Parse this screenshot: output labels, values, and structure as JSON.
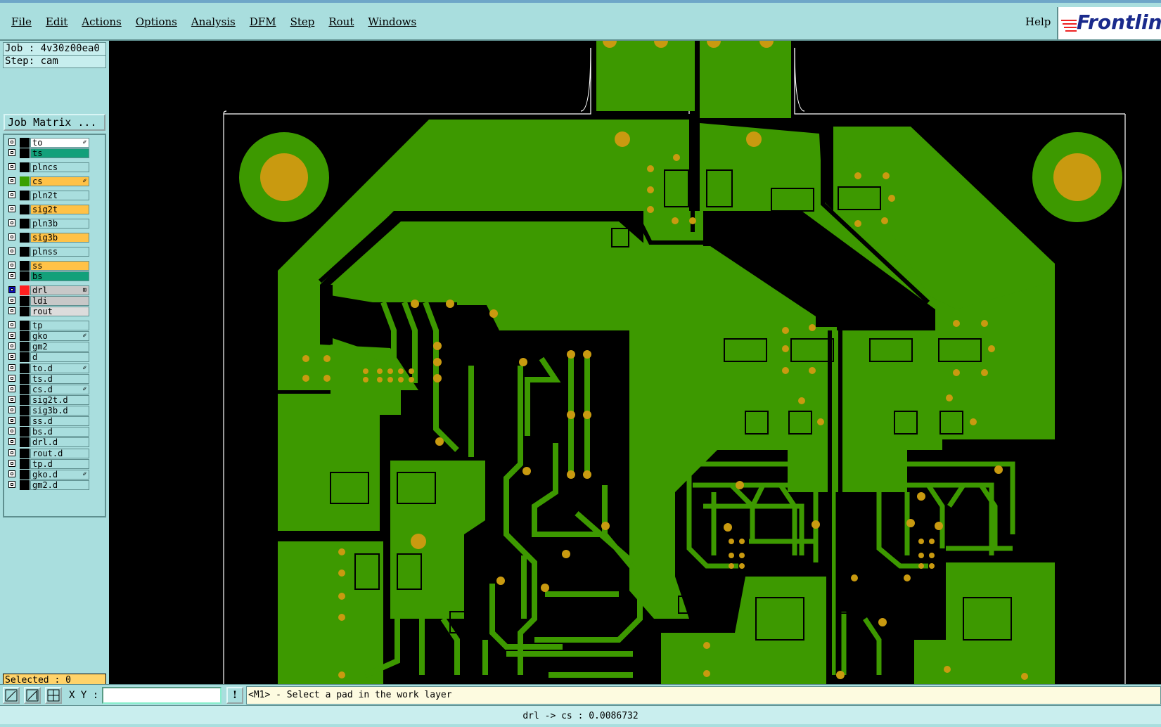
{
  "menu": {
    "items": [
      "File",
      "Edit",
      "Actions",
      "Options",
      "Analysis",
      "DFM",
      "Step",
      "Rout",
      "Windows"
    ],
    "help": "Help",
    "logo": "Frontline"
  },
  "job": {
    "label": "Job : 4v30z00ea0"
  },
  "step": {
    "label": "Step: cam"
  },
  "job_matrix_button": "Job Matrix ...",
  "layers": [
    {
      "name": "to",
      "bg": "#ffffff",
      "swatch": "#000000",
      "mark": "✐"
    },
    {
      "name": "ts",
      "bg": "#13a07a",
      "swatch": "#000000",
      "mark": ""
    },
    {
      "name": "plncs",
      "bg": "#a9dede",
      "swatch": "#000000",
      "mark": ""
    },
    {
      "name": "cs",
      "bg": "#ffc247",
      "swatch": "#3aa000",
      "mark": "✐"
    },
    {
      "name": "pln2t",
      "bg": "#a9dede",
      "swatch": "#000000",
      "mark": ""
    },
    {
      "name": "sig2t",
      "bg": "#ffc247",
      "swatch": "#000000",
      "mark": ""
    },
    {
      "name": "pln3b",
      "bg": "#a9dede",
      "swatch": "#000000",
      "mark": ""
    },
    {
      "name": "sig3b",
      "bg": "#ffc247",
      "swatch": "#000000",
      "mark": ""
    },
    {
      "name": "plnss",
      "bg": "#a9dede",
      "swatch": "#000000",
      "mark": ""
    },
    {
      "name": "ss",
      "bg": "#ffc247",
      "swatch": "#000000",
      "mark": ""
    },
    {
      "name": "bs",
      "bg": "#13a07a",
      "swatch": "#000000",
      "mark": ""
    },
    {
      "name": "drl",
      "bg": "#c8c8c8",
      "swatch": "#ff2020",
      "mark": "⊞",
      "active": true
    },
    {
      "name": "ldi",
      "bg": "#c8c8c8",
      "swatch": "#000000",
      "mark": ""
    },
    {
      "name": "rout",
      "bg": "#dcdcdc",
      "swatch": "#000000",
      "mark": ""
    },
    {
      "name": "tp",
      "bg": "#a9dede",
      "swatch": "#000000",
      "mark": ""
    },
    {
      "name": "gko",
      "bg": "#a9dede",
      "swatch": "#000000",
      "mark": "✐"
    },
    {
      "name": "gm2",
      "bg": "#a9dede",
      "swatch": "#000000",
      "mark": ""
    },
    {
      "name": "d",
      "bg": "#a9dede",
      "swatch": "#000000",
      "mark": ""
    },
    {
      "name": "to.d",
      "bg": "#a9dede",
      "swatch": "#000000",
      "mark": "✐"
    },
    {
      "name": "ts.d",
      "bg": "#a9dede",
      "swatch": "#000000",
      "mark": ""
    },
    {
      "name": "cs.d",
      "bg": "#a9dede",
      "swatch": "#000000",
      "mark": "✐"
    },
    {
      "name": "sig2t.d",
      "bg": "#a9dede",
      "swatch": "#000000",
      "mark": ""
    },
    {
      "name": "sig3b.d",
      "bg": "#a9dede",
      "swatch": "#000000",
      "mark": ""
    },
    {
      "name": "ss.d",
      "bg": "#a9dede",
      "swatch": "#000000",
      "mark": ""
    },
    {
      "name": "bs.d",
      "bg": "#a9dede",
      "swatch": "#000000",
      "mark": ""
    },
    {
      "name": "drl.d",
      "bg": "#a9dede",
      "swatch": "#000000",
      "mark": ""
    },
    {
      "name": "rout.d",
      "bg": "#a9dede",
      "swatch": "#000000",
      "mark": ""
    },
    {
      "name": "tp.d",
      "bg": "#a9dede",
      "swatch": "#000000",
      "mark": ""
    },
    {
      "name": "gko.d",
      "bg": "#a9dede",
      "swatch": "#000000",
      "mark": "✐"
    },
    {
      "name": "gm2.d",
      "bg": "#a9dede",
      "swatch": "#000000",
      "mark": ""
    }
  ],
  "selected": "Selected : 0",
  "coords": {
    "label": "X Y :",
    "value": ""
  },
  "prompt": "<M1> - Select a pad in the work layer",
  "status": "drl -> cs : 0.0086732",
  "colors": {
    "copper": "#3d9900",
    "pad": "#c99a10",
    "outline": "#ffffff"
  },
  "icons": [
    "measure-icon",
    "measure-angle-icon",
    "snap-grid-icon",
    "exclamation-icon"
  ]
}
